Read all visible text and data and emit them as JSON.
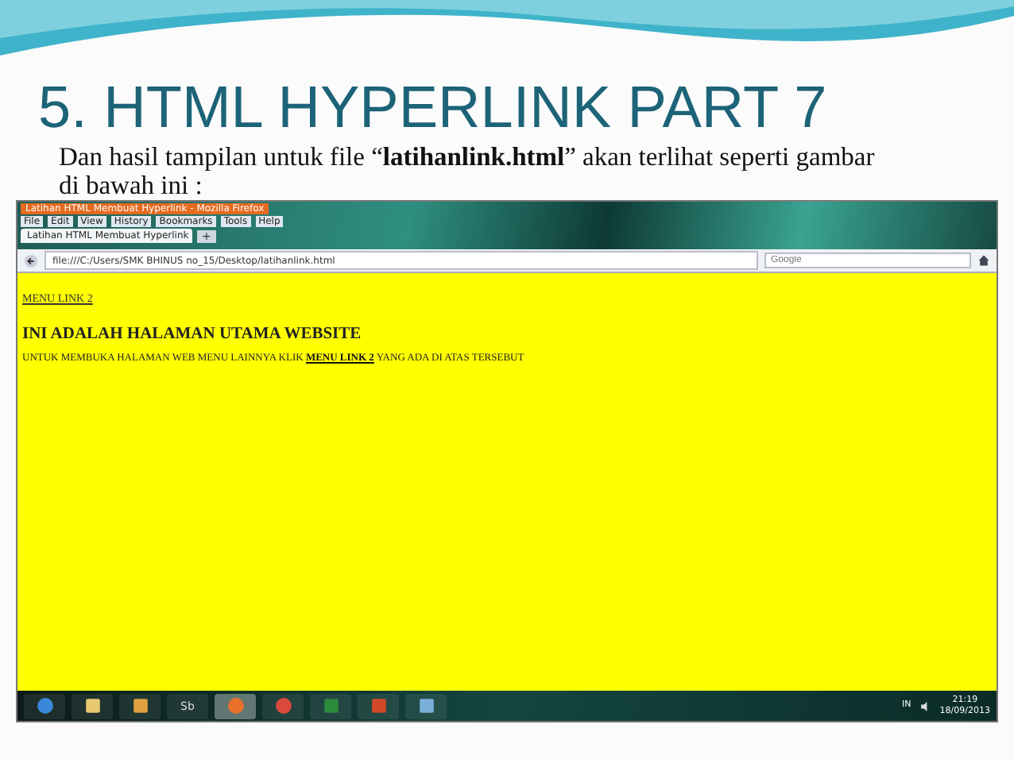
{
  "slide": {
    "title": "5. HTML HYPERLINK PART 7",
    "text": "Dan hasil tampilan untuk file “**latihanlink.html**” akan terlihat seperti gambar di bawah ini :"
  },
  "browser": {
    "window_title": "Latihan HTML Membuat Hyperlink - Mozilla Firefox",
    "menu": [
      "File",
      "Edit",
      "View",
      "History",
      "Bookmarks",
      "Tools",
      "Help"
    ],
    "tab": {
      "label": "Latihan HTML Membuat Hyperlink",
      "selected": true
    },
    "new_tab": "+",
    "url": "file:///C:/Users/SMK BHINUS no_15/Desktop/latihanlink.html",
    "search": {
      "placeholder": "Google"
    },
    "page": {
      "link": "MENU LINK 2",
      "heading": "INI ADALAH HALAMAN UTAMA WEBSITE",
      "before": "UNTUK MEMBUKA HALAMAN WEB MENU LAINNYA KLIK",
      "inline_link": "MENU LINK 2",
      "after": "YANG ADA DI ATAS TERSEBUT"
    }
  },
  "taskbar": {
    "apps": [
      {
        "kind": "start"
      },
      {
        "kind": "folder"
      },
      {
        "kind": "tool"
      },
      {
        "kind": "text",
        "label": "Sb"
      },
      {
        "kind": "firefox",
        "selected": true
      },
      {
        "kind": "chrome"
      },
      {
        "kind": "excel"
      },
      {
        "kind": "powerpoint"
      },
      {
        "kind": "generic"
      }
    ],
    "language": "IN",
    "time": "21:19",
    "date": "18/09/2013"
  }
}
